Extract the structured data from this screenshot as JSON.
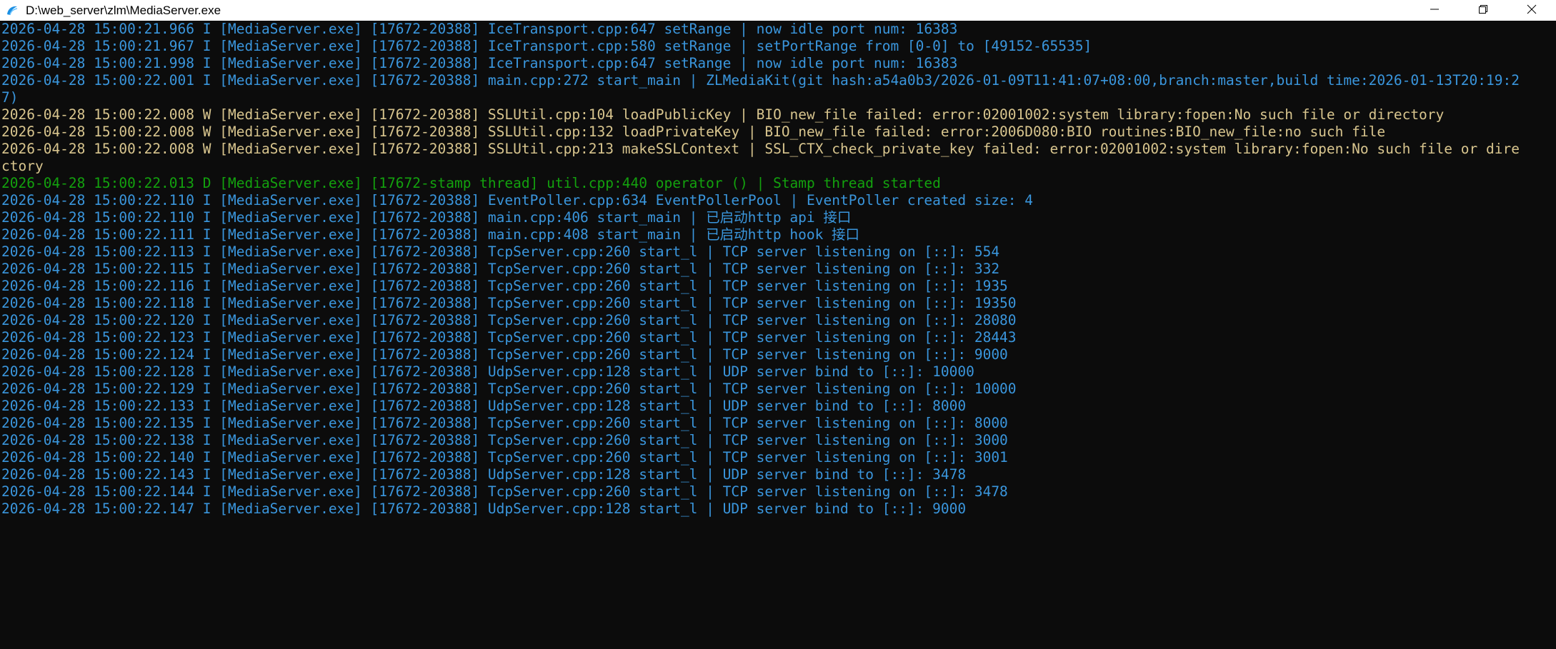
{
  "window": {
    "title": "D:\\web_server\\zlm\\MediaServer.exe",
    "app_icon": "zlm-app-icon",
    "controls": {
      "minimize_icon": "minimize-icon",
      "maximize_icon": "restore-icon",
      "close_icon": "close-icon"
    }
  },
  "colors": {
    "background": "#0c0c0c",
    "info": "#3a96dd",
    "warning": "#d8c58e",
    "debug": "#13a10e"
  },
  "log_lines": [
    {
      "level": "I",
      "text": "2026-04-28 15:00:21.966 I [MediaServer.exe] [17672-20388] IceTransport.cpp:647 setRange | now idle port num: 16383"
    },
    {
      "level": "I",
      "text": "2026-04-28 15:00:21.967 I [MediaServer.exe] [17672-20388] IceTransport.cpp:580 setRange | setPortRange from [0-0] to [49152-65535]"
    },
    {
      "level": "I",
      "text": "2026-04-28 15:00:21.998 I [MediaServer.exe] [17672-20388] IceTransport.cpp:647 setRange | now idle port num: 16383"
    },
    {
      "level": "I",
      "text": "2026-04-28 15:00:22.001 I [MediaServer.exe] [17672-20388] main.cpp:272 start_main | ZLMediaKit(git hash:a54a0b3/2026-01-09T11:41:07+08:00,branch:master,build time:2026-01-13T20:19:2"
    },
    {
      "level": "I",
      "text": "7)"
    },
    {
      "level": "W",
      "text": "2026-04-28 15:00:22.008 W [MediaServer.exe] [17672-20388] SSLUtil.cpp:104 loadPublicKey | BIO_new_file failed: error:02001002:system library:fopen:No such file or directory"
    },
    {
      "level": "W",
      "text": "2026-04-28 15:00:22.008 W [MediaServer.exe] [17672-20388] SSLUtil.cpp:132 loadPrivateKey | BIO_new_file failed: error:2006D080:BIO routines:BIO_new_file:no such file"
    },
    {
      "level": "W",
      "text": "2026-04-28 15:00:22.008 W [MediaServer.exe] [17672-20388] SSLUtil.cpp:213 makeSSLContext | SSL_CTX_check_private_key failed: error:02001002:system library:fopen:No such file or dire"
    },
    {
      "level": "W",
      "text": "ctory"
    },
    {
      "level": "D",
      "text": "2026-04-28 15:00:22.013 D [MediaServer.exe] [17672-stamp thread] util.cpp:440 operator () | Stamp thread started"
    },
    {
      "level": "I",
      "text": "2026-04-28 15:00:22.110 I [MediaServer.exe] [17672-20388] EventPoller.cpp:634 EventPollerPool | EventPoller created size: 4"
    },
    {
      "level": "I",
      "text": "2026-04-28 15:00:22.110 I [MediaServer.exe] [17672-20388] main.cpp:406 start_main | 已启动http api 接口"
    },
    {
      "level": "I",
      "text": "2026-04-28 15:00:22.111 I [MediaServer.exe] [17672-20388] main.cpp:408 start_main | 已启动http hook 接口"
    },
    {
      "level": "I",
      "text": "2026-04-28 15:00:22.113 I [MediaServer.exe] [17672-20388] TcpServer.cpp:260 start_l | TCP server listening on [::]: 554"
    },
    {
      "level": "I",
      "text": "2026-04-28 15:00:22.115 I [MediaServer.exe] [17672-20388] TcpServer.cpp:260 start_l | TCP server listening on [::]: 332"
    },
    {
      "level": "I",
      "text": "2026-04-28 15:00:22.116 I [MediaServer.exe] [17672-20388] TcpServer.cpp:260 start_l | TCP server listening on [::]: 1935"
    },
    {
      "level": "I",
      "text": "2026-04-28 15:00:22.118 I [MediaServer.exe] [17672-20388] TcpServer.cpp:260 start_l | TCP server listening on [::]: 19350"
    },
    {
      "level": "I",
      "text": "2026-04-28 15:00:22.120 I [MediaServer.exe] [17672-20388] TcpServer.cpp:260 start_l | TCP server listening on [::]: 28080"
    },
    {
      "level": "I",
      "text": "2026-04-28 15:00:22.123 I [MediaServer.exe] [17672-20388] TcpServer.cpp:260 start_l | TCP server listening on [::]: 28443"
    },
    {
      "level": "I",
      "text": "2026-04-28 15:00:22.124 I [MediaServer.exe] [17672-20388] TcpServer.cpp:260 start_l | TCP server listening on [::]: 9000"
    },
    {
      "level": "I",
      "text": "2026-04-28 15:00:22.128 I [MediaServer.exe] [17672-20388] UdpServer.cpp:128 start_l | UDP server bind to [::]: 10000"
    },
    {
      "level": "I",
      "text": "2026-04-28 15:00:22.129 I [MediaServer.exe] [17672-20388] TcpServer.cpp:260 start_l | TCP server listening on [::]: 10000"
    },
    {
      "level": "I",
      "text": "2026-04-28 15:00:22.133 I [MediaServer.exe] [17672-20388] UdpServer.cpp:128 start_l | UDP server bind to [::]: 8000"
    },
    {
      "level": "I",
      "text": "2026-04-28 15:00:22.135 I [MediaServer.exe] [17672-20388] TcpServer.cpp:260 start_l | TCP server listening on [::]: 8000"
    },
    {
      "level": "I",
      "text": "2026-04-28 15:00:22.138 I [MediaServer.exe] [17672-20388] TcpServer.cpp:260 start_l | TCP server listening on [::]: 3000"
    },
    {
      "level": "I",
      "text": "2026-04-28 15:00:22.140 I [MediaServer.exe] [17672-20388] TcpServer.cpp:260 start_l | TCP server listening on [::]: 3001"
    },
    {
      "level": "I",
      "text": "2026-04-28 15:00:22.143 I [MediaServer.exe] [17672-20388] UdpServer.cpp:128 start_l | UDP server bind to [::]: 3478"
    },
    {
      "level": "I",
      "text": "2026-04-28 15:00:22.144 I [MediaServer.exe] [17672-20388] TcpServer.cpp:260 start_l | TCP server listening on [::]: 3478"
    },
    {
      "level": "I",
      "text": "2026-04-28 15:00:22.147 I [MediaServer.exe] [17672-20388] UdpServer.cpp:128 start_l | UDP server bind to [::]: 9000"
    }
  ]
}
